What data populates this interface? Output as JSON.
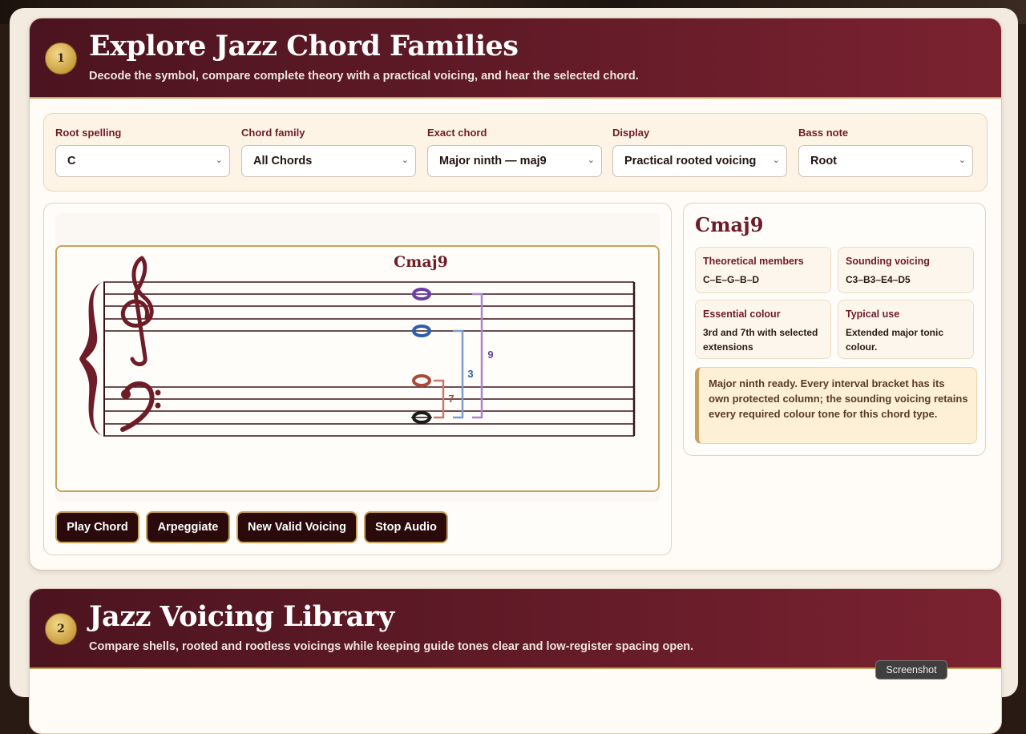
{
  "section1": {
    "number": "1",
    "title": "Explore Jazz Chord Families",
    "subtitle": "Decode the symbol, compare complete theory with a practical voicing, and hear the selected chord."
  },
  "controls": [
    {
      "label": "Root spelling",
      "value": "C"
    },
    {
      "label": "Chord family",
      "value": "All Chords"
    },
    {
      "label": "Exact chord",
      "value": "Major ninth — maj9"
    },
    {
      "label": "Display",
      "value": "Practical rooted voicing"
    },
    {
      "label": "Bass note",
      "value": "Root"
    }
  ],
  "notation": {
    "chord_symbol": "Cmaj9",
    "interval_labels": [
      "7",
      "3",
      "9"
    ],
    "colors": {
      "staff": "#3a1418",
      "clef": "#6d1c28",
      "root": "#1a1a1a",
      "seventh": "#a84a3a",
      "third": "#2f5ea8",
      "ninth": "#6b3fa0"
    }
  },
  "buttons": {
    "play": "Play Chord",
    "arpeggiate": "Arpeggiate",
    "new_voicing": "New Valid Voicing",
    "stop": "Stop Audio"
  },
  "info": {
    "title": "Cmaj9",
    "theoretical_label": "Theoretical members",
    "theoretical_value": "C–E–G–B–D",
    "sounding_label": "Sounding voicing",
    "sounding_value": "C3–B3–E4–D5",
    "essential_label": "Essential colour",
    "essential_value": "3rd and 7th with selected extensions",
    "use_label": "Typical use",
    "use_value": "Extended major tonic colour.",
    "notice": "Major ninth ready. Every interval bracket has its own protected column; the sounding voicing retains every required colour tone for this chord type."
  },
  "section2": {
    "number": "2",
    "title": "Jazz Voicing Library",
    "subtitle": "Compare shells, rooted and rootless voicings while keeping guide tones clear and low-register spacing open."
  },
  "overlay": {
    "screenshot_label": "Screenshot"
  },
  "icons": {
    "select_chevron": "chevron-down-icon"
  }
}
